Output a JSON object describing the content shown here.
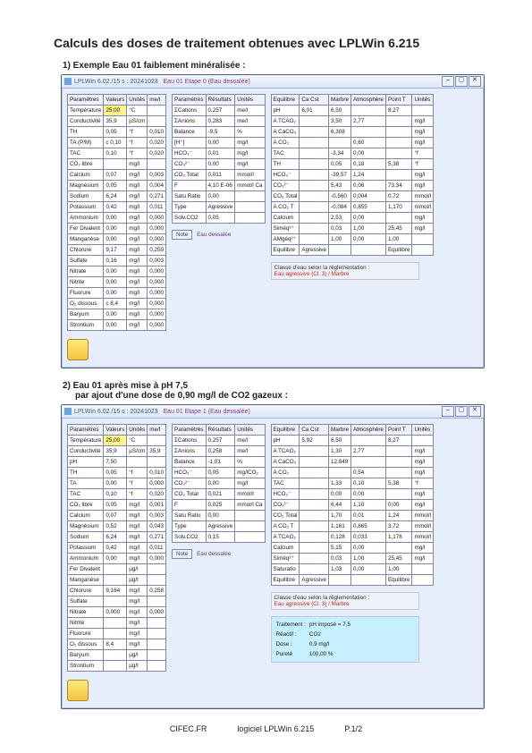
{
  "page": {
    "title": "Calculs des doses de traitement obtenues avec LPLWin 6.215",
    "sub1": "1) Exemple Eau 01 faiblement minéralisée :",
    "sub2a": "2) Eau 01 après mise à pH 7,5",
    "sub2b": "par ajout d'une dose de 0,90 mg/l de CO2 gazeux :"
  },
  "win1": {
    "caption_prefix": "LPLWin 6.02./15 s : 20241023",
    "caption_etape": "Eau 01 Etape 0 (Eau dessalée)",
    "paramHeader": [
      "Paramètres",
      "Valeurs",
      "Unités",
      "me/l"
    ],
    "params": [
      [
        "Température",
        "25,00",
        "°C",
        ""
      ],
      [
        "Conductivité",
        "35,9",
        "µS/cm",
        ""
      ],
      [
        "TH",
        "0,05",
        "°f",
        "0,010"
      ],
      [
        "TA (P/M)",
        "c 0,10",
        "°f",
        "0,020"
      ],
      [
        "TAC",
        "0,10",
        "°f",
        "0,020"
      ],
      [
        "CO₂ libre",
        "",
        "mg/l",
        ""
      ],
      [
        "Calcium",
        "0,07",
        "mg/l",
        "0,003"
      ],
      [
        "Magnésium",
        "0,05",
        "mg/l",
        "0,004"
      ],
      [
        "Sodium",
        "6,24",
        "mg/l",
        "0,271"
      ],
      [
        "Potassium",
        "0,42",
        "mg/l",
        "0,011"
      ],
      [
        "Ammonium",
        "0,00",
        "mg/l",
        "0,000"
      ],
      [
        "Fer Divalent",
        "0,00",
        "mg/l",
        "0,000"
      ],
      [
        "Manganèse",
        "0,00",
        "mg/l",
        "0,000"
      ],
      [
        "Chlorure",
        "9,17",
        "mg/l",
        "0,259"
      ],
      [
        "Sulfate",
        "0,16",
        "mg/l",
        "0,003"
      ],
      [
        "Nitrate",
        "0,00",
        "mg/l",
        "0,000"
      ],
      [
        "Nitrite",
        "0,00",
        "mg/l",
        "0,000"
      ],
      [
        "Fluorure",
        "0,00",
        "mg/l",
        "0,000"
      ],
      [
        "O₂ dissous",
        "c 8,4",
        "mg/l",
        "0,000"
      ],
      [
        "Baryum",
        "0,00",
        "mg/l",
        "0,000"
      ],
      [
        "Strontium",
        "0,00",
        "mg/l",
        "0,000"
      ]
    ],
    "temp_badge": "25,00",
    "resultHeader": [
      "Paramètres",
      "Résultats",
      "Unités"
    ],
    "results": [
      [
        "ΣCations",
        "0,257",
        "me/l"
      ],
      [
        "ΣAnions",
        "0,283",
        "me/l"
      ],
      [
        "Balance",
        "-9,5",
        "%"
      ],
      [
        "[H⁺]",
        "0,00",
        "mg/l"
      ],
      [
        "HCO₃⁻",
        "0,01",
        "mg/l"
      ],
      [
        "CO₃²⁻",
        "0,00",
        "mg/l"
      ],
      [
        "CO₂ Total",
        "0,011",
        "mmol/l"
      ],
      [
        "F",
        "4,10 E-06",
        "mmol/l Ca"
      ],
      [
        "Satu Ratio",
        "0,00",
        ""
      ],
      [
        "Type",
        "Agressive",
        ""
      ],
      [
        "Solv.CO2",
        "0,05",
        ""
      ]
    ],
    "note_btn": "Note",
    "note_text": "Eau dessalée",
    "equilHeader": [
      "Equilibre",
      "Ca Cst",
      "Marbre",
      "Atmosphère",
      "Point T",
      "Unités"
    ],
    "equil": [
      [
        "pH",
        "6,01",
        "6,50",
        "",
        "8,27",
        ""
      ],
      [
        "A TCAO₂",
        "",
        "3,50",
        "2,77",
        "",
        "mg/l"
      ],
      [
        "A CaCO₃",
        "",
        "6,308",
        "",
        "",
        "mg/l"
      ],
      [
        "A CO₂",
        "",
        "",
        "0,60",
        "",
        "mg/l"
      ],
      [
        "TAC",
        "",
        "-3,34",
        "0,00",
        "",
        "°f"
      ],
      [
        "TH",
        "",
        "0,05",
        "0,18",
        "5,38",
        "°f"
      ],
      [
        "HCO₃⁻",
        "",
        "-39,57",
        "1,24",
        "",
        "mg/l"
      ],
      [
        "CO₃²⁻",
        "",
        "5,43",
        "0,06",
        "73,34",
        "mg/l"
      ],
      [
        "CO₂ Total",
        "",
        "-0,560",
        "0,004",
        "0,72",
        "mmol/l"
      ],
      [
        "A CO₂ T",
        "",
        "-0,084",
        "0,855",
        "1,170",
        "mmol/l"
      ],
      [
        "Calcium",
        "",
        "2,53",
        "0,00",
        "",
        "mg/l"
      ],
      [
        "Siméq²⁺",
        "",
        "0,03",
        "1,00",
        "25,45",
        "mg/l"
      ],
      [
        "AMgéq²⁺",
        "",
        "1,00",
        "0,00",
        "1,00",
        ""
      ],
      [
        "Equilibre",
        "Agressive",
        "",
        "",
        "Equilibre",
        ""
      ]
    ],
    "class_title": "Classe d'eau selon la réglementation :",
    "class_text": "Eau agressive (Cl. 3) / Marbre"
  },
  "win2": {
    "caption_prefix": "LPLWin 6.02./15 s : 20241023",
    "caption_etape": "Eau 01 Etape 1 (Eau dessalée)",
    "paramHeader": [
      "Paramètres",
      "Valeurs",
      "Unités",
      "me/l"
    ],
    "temp_badge": "25,00",
    "params": [
      [
        "Température",
        "25,00",
        "°C",
        ""
      ],
      [
        "Conductivité",
        "35,9",
        "µS/cm",
        "35,9"
      ],
      [
        "pH",
        "7,50",
        "",
        ""
      ],
      [
        "TH",
        "0,05",
        "°f",
        "0,010"
      ],
      [
        "TA",
        "0,00",
        "°f",
        "0,000"
      ],
      [
        "TAC",
        "0,10",
        "°f",
        "0,020"
      ],
      [
        "CO₂ libre",
        "0,05",
        "mg/l",
        "0,001"
      ],
      [
        "Calcium",
        "0,07",
        "mg/l",
        "0,003"
      ],
      [
        "Magnésium",
        "0,52",
        "mg/l",
        "0,043"
      ],
      [
        "Sodium",
        "6,24",
        "mg/l",
        "0,271"
      ],
      [
        "Potassium",
        "0,42",
        "mg/l",
        "0,011"
      ],
      [
        "Ammonium",
        "0,00",
        "mg/l",
        "0,000"
      ],
      [
        "Fer Divalent",
        "",
        "µg/l",
        ""
      ],
      [
        "Manganèse",
        "",
        "µg/l",
        ""
      ],
      [
        "Chlorure",
        "9,164",
        "mg/l",
        "0,258"
      ],
      [
        "Sulfate",
        "",
        "mg/l",
        ""
      ],
      [
        "Nitrate",
        "0,000",
        "mg/l",
        "0,000"
      ],
      [
        "Nitrite",
        "",
        "mg/l",
        ""
      ],
      [
        "Fluorure",
        "",
        "mg/l",
        ""
      ],
      [
        "O₂ dissous",
        "8,4",
        "mg/l",
        ""
      ],
      [
        "Baryum",
        "",
        "µg/l",
        ""
      ],
      [
        "Strontium",
        "",
        "µg/l",
        ""
      ]
    ],
    "resultHeader": [
      "Paramètres",
      "Résultats",
      "Unités"
    ],
    "results": [
      [
        "ΣCations",
        "0,257",
        "me/l"
      ],
      [
        "ΣAnions",
        "0,258",
        "me/l"
      ],
      [
        "Balance",
        "-1,01",
        "%"
      ],
      [
        "HCO₃⁻",
        "0,05",
        "mg/lCO₂"
      ],
      [
        "CO₃²⁻",
        "0,00",
        "mg/l"
      ],
      [
        "CO₂ Total",
        "0,021",
        "mmol/l"
      ],
      [
        "F",
        "0,025",
        "mmol/l Ca"
      ],
      [
        "Satu Ratio",
        "0,00",
        ""
      ],
      [
        "Type",
        "Agressive",
        ""
      ],
      [
        "Solv.CO2",
        "0,15",
        ""
      ]
    ],
    "note_btn": "Note",
    "note_text": "Eau dessalée",
    "equilHeader": [
      "Equilibre",
      "Ca Cst",
      "Marbre",
      "Atmosphère",
      "Point T",
      "Unités"
    ],
    "equil": [
      [
        "pH",
        "5,92",
        "6,50",
        "",
        "8,27",
        ""
      ],
      [
        "A TCAO₂",
        "",
        "1,30",
        "2,77",
        "",
        "mg/l"
      ],
      [
        "A CaCO₃",
        "",
        "12,849",
        "",
        "",
        "mg/l"
      ],
      [
        "A CO₂",
        "",
        "",
        "0,54",
        "",
        "mg/l"
      ],
      [
        "TAC",
        "",
        "1,33",
        "0,10",
        "5,38",
        "°f"
      ],
      [
        "HCO₃⁻",
        "",
        "0,00",
        "0,00",
        "",
        "mg/l"
      ],
      [
        "CO₃²⁻",
        "",
        "6,44",
        "1,10",
        "0,00",
        "mg/l"
      ],
      [
        "CO₂ Total",
        "",
        "1,70",
        "0,01",
        "1,24",
        "mmol/l"
      ],
      [
        "A CO₂ T",
        "",
        "1,161",
        "0,865",
        "3,72",
        "mmol/l"
      ],
      [
        "A TCAO₂",
        "",
        "0,128",
        "0,033",
        "1,176",
        "mmol/l"
      ],
      [
        "Calcium",
        "",
        "5,15",
        "0,00",
        "",
        "mg/l"
      ],
      [
        "Siméq²⁺",
        "",
        "0,03",
        "1,00",
        "25,45",
        "mg/l"
      ],
      [
        "Saturatio",
        "",
        "1,03",
        "0,00",
        "1,00",
        ""
      ],
      [
        "Equilibre",
        "Agressive",
        "",
        "",
        "Equilibre",
        ""
      ]
    ],
    "class_title": "Classe d'eau selon la réglementation :",
    "class_text": "Eau agressive (Cl. 3) / Marbre",
    "trait": {
      "h_trait": "Traitement :",
      "v_trait": "pH imposé = 7,5",
      "h_react": "Réactif :",
      "v_react": "CO2",
      "h_dose": "Dose :",
      "v_dose": "0,9 mg/l",
      "h_pur": "Pureté",
      "v_pur": "100,00 %"
    }
  },
  "footer": {
    "left": "CIFEC.FR",
    "mid": "logiciel LPLWin 6.215",
    "right": "P.1/2"
  }
}
